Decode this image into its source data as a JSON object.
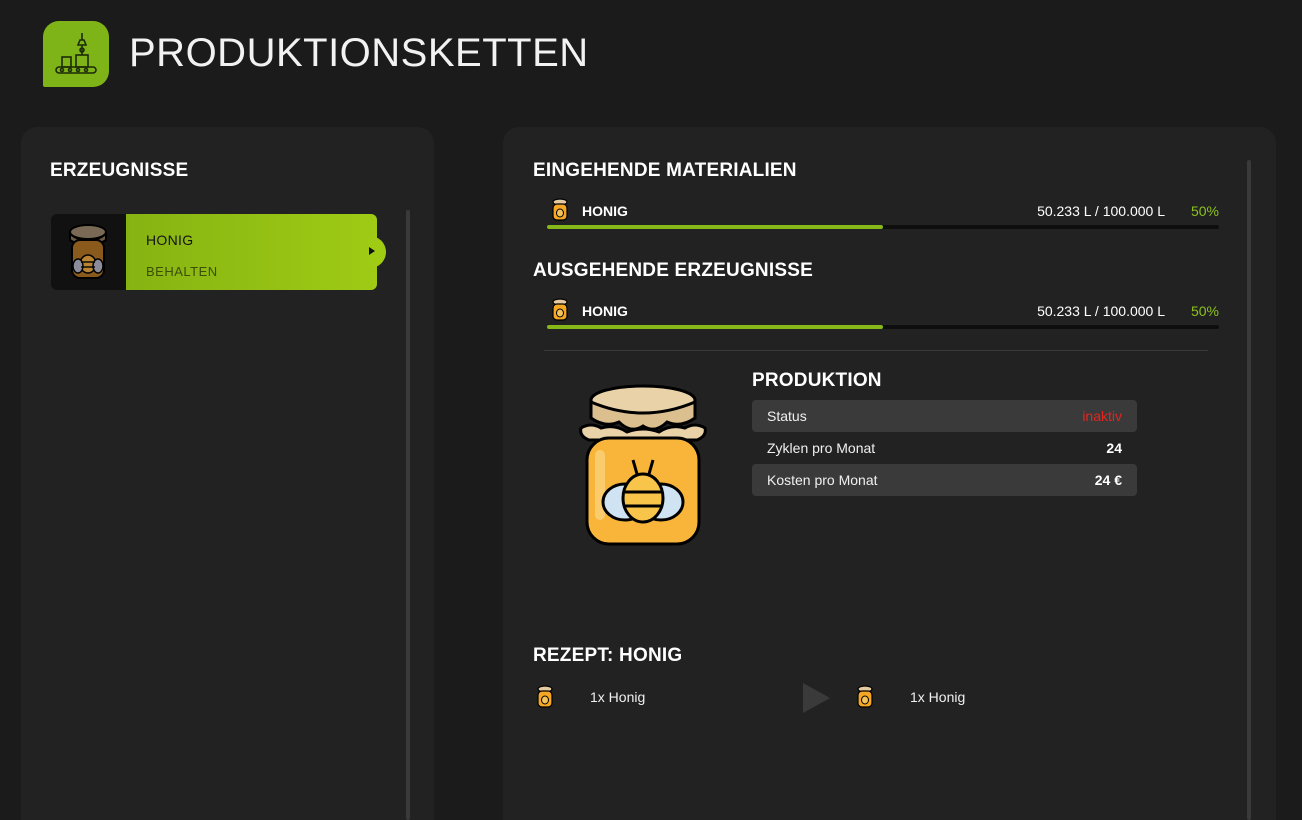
{
  "page": {
    "title": "PRODUKTIONSKETTEN",
    "icon": "production-chain-icon",
    "accent": "#7fb418"
  },
  "left_panel": {
    "title": "ERZEUGNISSE",
    "items": [
      {
        "name": "HONIG",
        "mode": "BEHALTEN",
        "icon": "honey-jar-icon",
        "selected": true
      }
    ]
  },
  "incoming": {
    "title": "EINGEHENDE MATERIALIEN",
    "items": [
      {
        "name": "HONIG",
        "amount": "50.233 L / 100.000 L",
        "percent": "50%",
        "fill": 0.5,
        "icon": "honey-jar-icon"
      }
    ]
  },
  "outgoing": {
    "title": "AUSGEHENDE ERZEUGNISSE",
    "items": [
      {
        "name": "HONIG",
        "amount": "50.233 L / 100.000 L",
        "percent": "50%",
        "fill": 0.5,
        "icon": "honey-jar-icon"
      }
    ]
  },
  "production": {
    "title": "PRODUKTION",
    "rows": [
      {
        "label": "Status",
        "value": "inaktiv",
        "status_color": "#e3241f"
      },
      {
        "label": "Zyklen pro Monat",
        "value": "24"
      },
      {
        "label": "Kosten pro Monat",
        "value": "24 €"
      }
    ]
  },
  "recipe": {
    "title": "REZEPT: HONIG",
    "input": "1x Honig",
    "output": "1x Honig",
    "arrow_icon": "play-icon"
  }
}
